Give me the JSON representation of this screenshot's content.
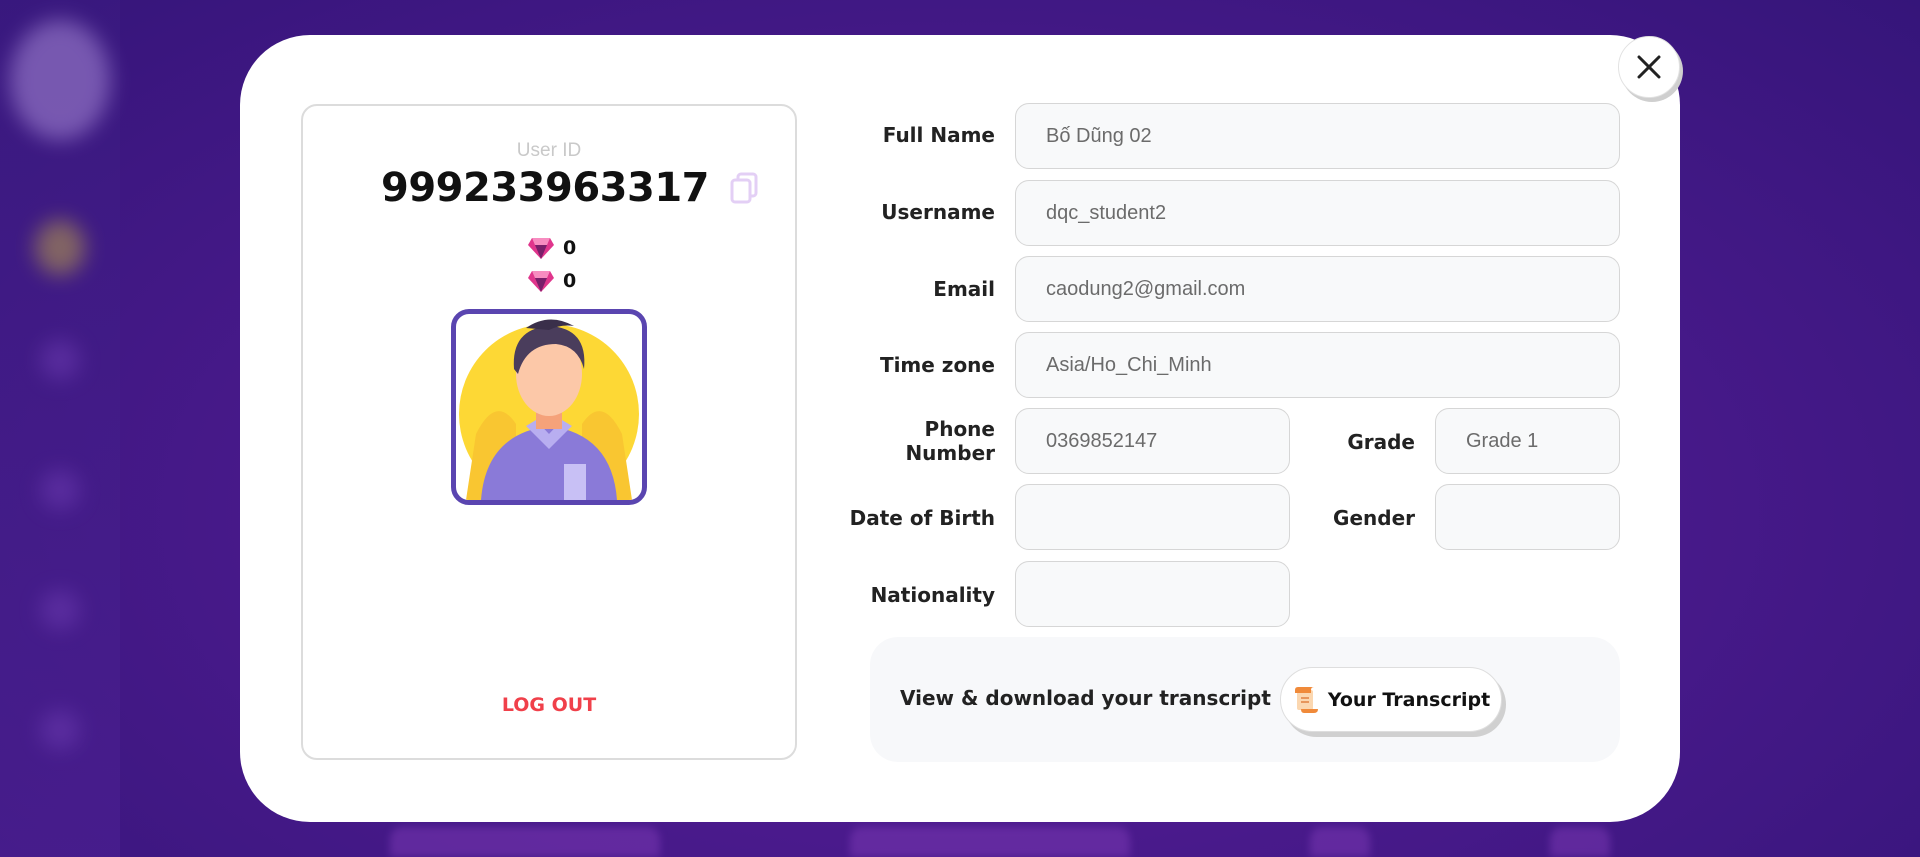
{
  "user": {
    "id_label": "User ID",
    "id_value": "999233963317",
    "gems": [
      "0",
      "0"
    ],
    "logout_label": "LOG OUT"
  },
  "form": {
    "full_name": {
      "label": "Full Name",
      "value": "Bố Dũng 02"
    },
    "username": {
      "label": "Username",
      "value": "dqc_student2"
    },
    "email": {
      "label": "Email",
      "value": "caodung2@gmail.com"
    },
    "timezone": {
      "label": "Time zone",
      "value": "Asia/Ho_Chi_Minh"
    },
    "phone": {
      "label_line1": "Phone",
      "label_line2": "Number",
      "value": "0369852147"
    },
    "grade": {
      "label": "Grade",
      "value": "Grade 1"
    },
    "dob": {
      "label": "Date of Birth",
      "value": ""
    },
    "gender": {
      "label": "Gender",
      "value": ""
    },
    "nationality": {
      "label": "Nationality",
      "value": ""
    }
  },
  "transcript": {
    "text": "View & download your transcript",
    "button_label": "Your Transcript"
  },
  "icons": {
    "close": "close-icon",
    "copy": "copy-icon",
    "gem": "gem-icon",
    "scroll": "scroll-icon"
  },
  "colors": {
    "accent_purple": "#5a45b0",
    "logout_red": "#f0404a",
    "background_purple": "#4a1a8c"
  }
}
